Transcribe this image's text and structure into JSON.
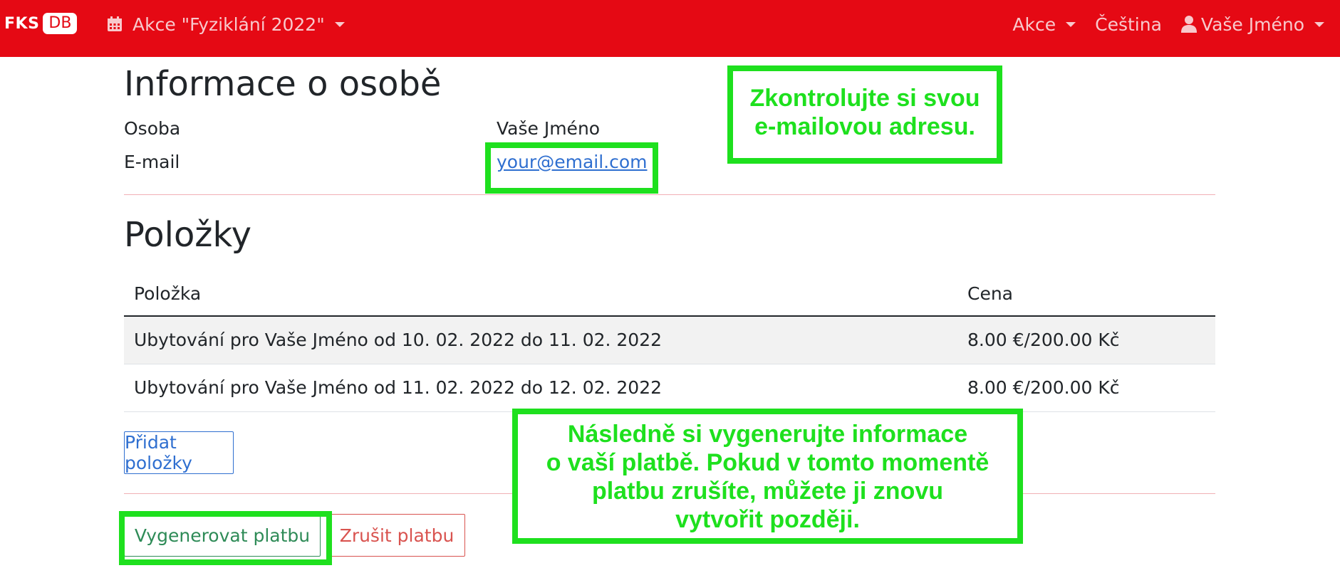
{
  "navbar": {
    "logo_text": "FKS",
    "logo_badge": "DB",
    "event_label": "Akce \"Fyziklání 2022\"",
    "right_items": [
      {
        "label": "Akce"
      },
      {
        "label": "Čeština"
      },
      {
        "label": "Vaše Jméno"
      }
    ]
  },
  "person_section": {
    "title": "Informace o osobě",
    "rows": [
      {
        "label": "Osoba",
        "value": "Vaše Jméno"
      },
      {
        "label": "E-mail",
        "value": "your@email.com"
      }
    ]
  },
  "items_section": {
    "title": "Položky",
    "columns": [
      "Položka",
      "Cena"
    ],
    "rows": [
      {
        "item": "Ubytování pro Vaše Jméno od 10. 02. 2022 do 11. 02. 2022",
        "price": "8.00 €/200.00 Kč"
      },
      {
        "item": "Ubytování pro Vaše Jméno od 11. 02. 2022 do 12. 02. 2022",
        "price": "8.00 €/200.00 Kč"
      }
    ],
    "add_button": "Přidat položky"
  },
  "actions": {
    "generate_button": "Vygenerovat platbu",
    "cancel_button": "Zrušit platbu"
  },
  "annotations": {
    "email_hint": [
      "Zkontrolujte si svou",
      "e-mailovou adresu."
    ],
    "payment_hint": [
      "Následně si vygenerujte informace",
      "o vaší platbě. Pokud v tomto momentě",
      "platbu zrušíte, můžete ji znovu",
      "vytvořit později."
    ],
    "highlight_color": "#1ee01e"
  },
  "theme": {
    "navbar_color": "#e50914",
    "link_color": "#2f6fd0",
    "success_color": "#2e8b57",
    "danger_color": "#d9534f"
  }
}
